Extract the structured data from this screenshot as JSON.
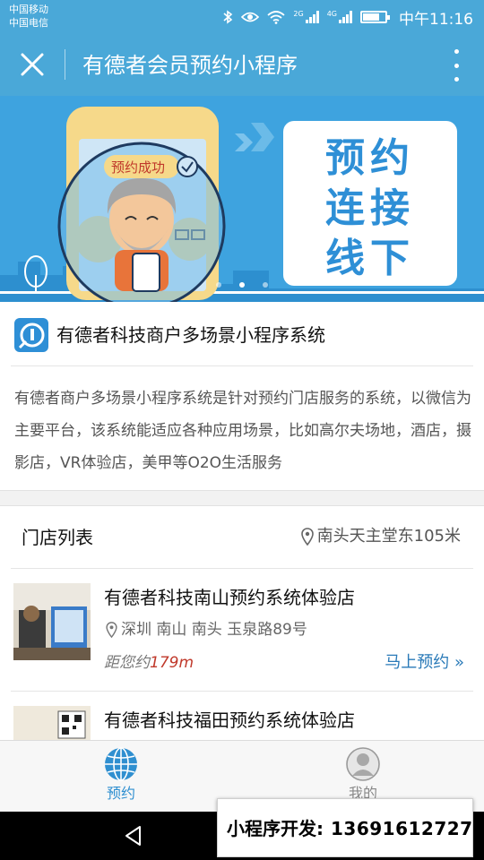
{
  "status_bar": {
    "carrier_1": "中国移动",
    "carrier_2": "中国电信",
    "network_1": "2G",
    "network_2": "4G",
    "time": "中午11:16",
    "icons": [
      "bluetooth-icon",
      "eye-icon",
      "wifi-icon",
      "signal-icon",
      "battery-icon"
    ]
  },
  "nav": {
    "title": "有德者会员预约小程序",
    "close_icon": "close-icon",
    "more_icon": "more-vertical-icon"
  },
  "banner": {
    "badge_text": "预约成功",
    "slogan": [
      "预约",
      "连接",
      "线下"
    ],
    "slide_count": 3,
    "active_slide": 2
  },
  "merchant": {
    "name": "有德者科技商户多场景小程序系统",
    "description": "有德者商户多场景小程序系统是针对预约门店服务的系统，以微信为主要平台，该系统能适应各种应用场景，比如高尔夫场地，酒店，摄影店，VR体验店，美甲等O2O生活服务"
  },
  "store_list": {
    "title": "门店列表",
    "location": "南头天主堂东105米",
    "stores": [
      {
        "name": "有德者科技南山预约系统体验店",
        "address": "深圳 南山 南头 玉泉路89号",
        "distance_prefix": "距您约",
        "distance_value": "179m",
        "action": "马上预约 »"
      },
      {
        "name": "有德者科技福田预约系统体验店"
      }
    ]
  },
  "tabbar": {
    "tabs": [
      {
        "label": "预约",
        "icon": "globe-icon",
        "active": true
      },
      {
        "label": "我的",
        "icon": "user-icon",
        "active": false
      }
    ]
  },
  "promo": {
    "label": "小程序开发:",
    "phone": "13691612727"
  },
  "colors": {
    "brand_blue": "#4aa8d8",
    "banner_blue": "#3ea3df",
    "link_blue": "#2a7ab8",
    "distance_red": "#c0392b"
  }
}
